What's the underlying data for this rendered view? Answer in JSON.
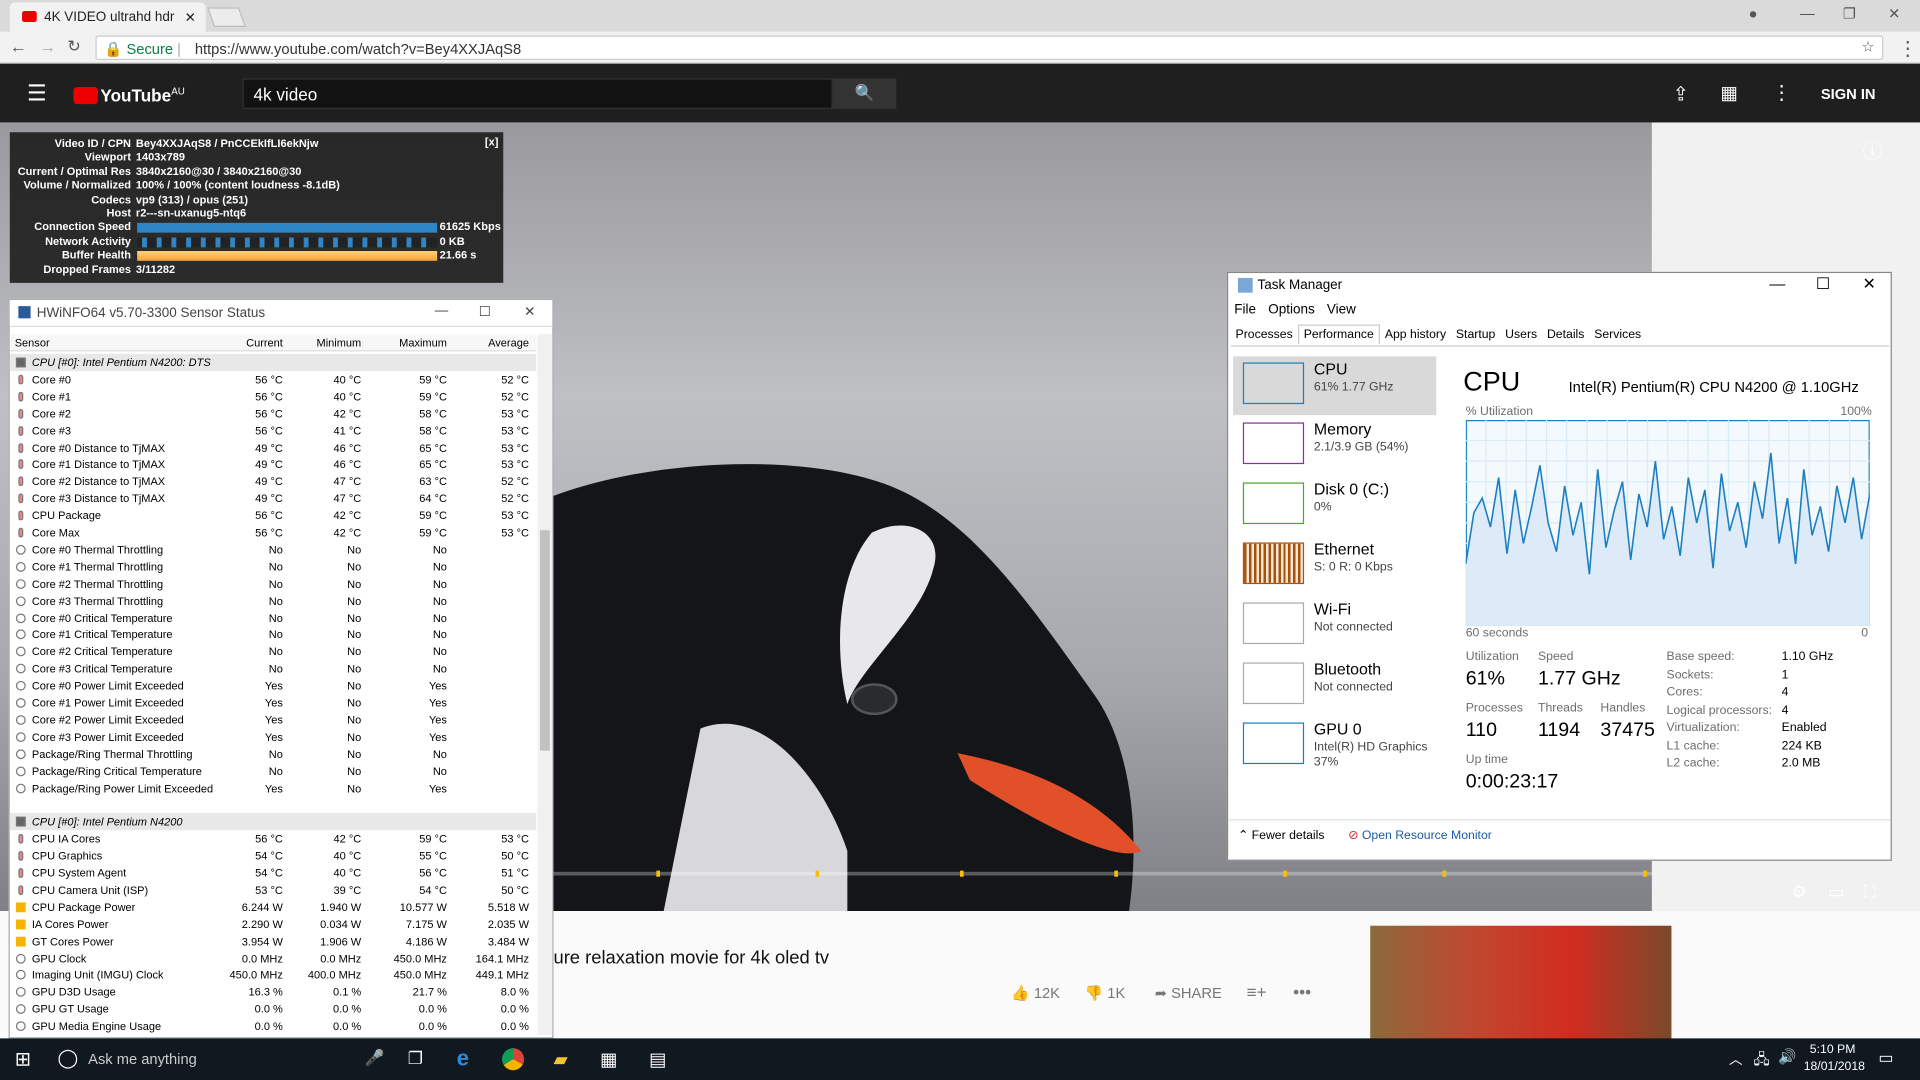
{
  "browser": {
    "tab_title": "4K VIDEO ultrahd hdr",
    "secure": "Secure",
    "url": "https://www.youtube.com/watch?v=Bey4XXJAqS8"
  },
  "youtube": {
    "logo": "YouTube",
    "region": "AU",
    "search_value": "4k video",
    "signin": "SIGN IN",
    "video_title": "ure relaxation movie for 4k oled tv",
    "likes": "12K",
    "dislikes": "1K",
    "share": "SHARE"
  },
  "stats": [
    {
      "label": "Video ID / CPN",
      "value": "Bey4XXJAqS8 / PnCCEkIfLI6ekNjw"
    },
    {
      "label": "Viewport",
      "value": "1403x789"
    },
    {
      "label": "Current / Optimal Res",
      "value": "3840x2160@30 / 3840x2160@30"
    },
    {
      "label": "Volume / Normalized",
      "value": "100% / 100% (content loudness -8.1dB)"
    },
    {
      "label": "Codecs",
      "value": "vp9 (313) / opus (251)"
    },
    {
      "label": "Host",
      "value": "r2---sn-uxanug5-ntq6"
    },
    {
      "label": "Connection Speed",
      "value": "61625 Kbps"
    },
    {
      "label": "Network Activity",
      "value": "0 KB"
    },
    {
      "label": "Buffer Health",
      "value": "21.66 s"
    },
    {
      "label": "Dropped Frames",
      "value": "3/11282"
    }
  ],
  "hwinfo": {
    "title": "HWiNFO64 v5.70-3300 Sensor Status",
    "columns": [
      "Sensor",
      "Current",
      "Minimum",
      "Maximum",
      "Average"
    ],
    "rows": [
      [
        "CPU [#0]: Intel Pentium N4200: DTS",
        "",
        "",
        "",
        ""
      ],
      [
        "Core #0",
        "56 °C",
        "40 °C",
        "59 °C",
        "52 °C"
      ],
      [
        "Core #1",
        "56 °C",
        "40 °C",
        "59 °C",
        "52 °C"
      ],
      [
        "Core #2",
        "56 °C",
        "42 °C",
        "58 °C",
        "53 °C"
      ],
      [
        "Core #3",
        "56 °C",
        "41 °C",
        "58 °C",
        "53 °C"
      ],
      [
        "Core #0 Distance to TjMAX",
        "49 °C",
        "46 °C",
        "65 °C",
        "53 °C"
      ],
      [
        "Core #1 Distance to TjMAX",
        "49 °C",
        "46 °C",
        "65 °C",
        "53 °C"
      ],
      [
        "Core #2 Distance to TjMAX",
        "49 °C",
        "47 °C",
        "63 °C",
        "52 °C"
      ],
      [
        "Core #3 Distance to TjMAX",
        "49 °C",
        "47 °C",
        "64 °C",
        "52 °C"
      ],
      [
        "CPU Package",
        "56 °C",
        "42 °C",
        "59 °C",
        "53 °C"
      ],
      [
        "Core Max",
        "56 °C",
        "42 °C",
        "59 °C",
        "53 °C"
      ],
      [
        "Core #0 Thermal Throttling",
        "No",
        "No",
        "No",
        ""
      ],
      [
        "Core #1 Thermal Throttling",
        "No",
        "No",
        "No",
        ""
      ],
      [
        "Core #2 Thermal Throttling",
        "No",
        "No",
        "No",
        ""
      ],
      [
        "Core #3 Thermal Throttling",
        "No",
        "No",
        "No",
        ""
      ],
      [
        "Core #0 Critical Temperature",
        "No",
        "No",
        "No",
        ""
      ],
      [
        "Core #1 Critical Temperature",
        "No",
        "No",
        "No",
        ""
      ],
      [
        "Core #2 Critical Temperature",
        "No",
        "No",
        "No",
        ""
      ],
      [
        "Core #3 Critical Temperature",
        "No",
        "No",
        "No",
        ""
      ],
      [
        "Core #0 Power Limit Exceeded",
        "Yes",
        "No",
        "Yes",
        ""
      ],
      [
        "Core #1 Power Limit Exceeded",
        "Yes",
        "No",
        "Yes",
        ""
      ],
      [
        "Core #2 Power Limit Exceeded",
        "Yes",
        "No",
        "Yes",
        ""
      ],
      [
        "Core #3 Power Limit Exceeded",
        "Yes",
        "No",
        "Yes",
        ""
      ],
      [
        "Package/Ring Thermal Throttling",
        "No",
        "No",
        "No",
        ""
      ],
      [
        "Package/Ring Critical Temperature",
        "No",
        "No",
        "No",
        ""
      ],
      [
        "Package/Ring Power Limit Exceeded",
        "Yes",
        "No",
        "Yes",
        ""
      ],
      [
        "",
        "",
        "",
        "",
        ""
      ],
      [
        "CPU [#0]: Intel Pentium N4200",
        "",
        "",
        "",
        ""
      ],
      [
        "CPU IA Cores",
        "56 °C",
        "42 °C",
        "59 °C",
        "53 °C"
      ],
      [
        "CPU Graphics",
        "54 °C",
        "40 °C",
        "55 °C",
        "50 °C"
      ],
      [
        "CPU System Agent",
        "54 °C",
        "40 °C",
        "56 °C",
        "51 °C"
      ],
      [
        "CPU Camera Unit (ISP)",
        "53 °C",
        "39 °C",
        "54 °C",
        "50 °C"
      ],
      [
        "CPU Package Power",
        "6.244 W",
        "1.940 W",
        "10.577 W",
        "5.518 W"
      ],
      [
        "IA Cores Power",
        "2.290 W",
        "0.034 W",
        "7.175 W",
        "2.035 W"
      ],
      [
        "GT Cores Power",
        "3.954 W",
        "1.906 W",
        "4.186 W",
        "3.484 W"
      ],
      [
        "GPU Clock",
        "0.0 MHz",
        "0.0 MHz",
        "450.0 MHz",
        "164.1 MHz"
      ],
      [
        "Imaging Unit (IMGU) Clock",
        "450.0 MHz",
        "400.0 MHz",
        "450.0 MHz",
        "449.1 MHz"
      ],
      [
        "GPU D3D Usage",
        "16.3 %",
        "0.1 %",
        "21.7 %",
        "8.0 %"
      ],
      [
        "GPU GT Usage",
        "0.0 %",
        "0.0 %",
        "0.0 %",
        "0.0 %"
      ],
      [
        "GPU Media Engine Usage",
        "0.0 %",
        "0.0 %",
        "0.0 %",
        "0.0 %"
      ]
    ]
  },
  "taskmgr": {
    "title": "Task Manager",
    "menu": [
      "File",
      "Options",
      "View"
    ],
    "tabs": [
      "Processes",
      "Performance",
      "App history",
      "Startup",
      "Users",
      "Details",
      "Services"
    ],
    "side": [
      {
        "name": "CPU",
        "sub": "61%  1.77 GHz",
        "color": "#1c7fc1"
      },
      {
        "name": "Memory",
        "sub": "2.1/3.9 GB (54%)",
        "color": "#8b2f9d"
      },
      {
        "name": "Disk 0 (C:)",
        "sub": "0%",
        "color": "#4ca730"
      },
      {
        "name": "Ethernet",
        "sub": "S: 0  R: 0 Kbps",
        "color": "#a7520b"
      },
      {
        "name": "Wi-Fi",
        "sub": "Not connected",
        "color": "#aaaaaa"
      },
      {
        "name": "Bluetooth",
        "sub": "Not connected",
        "color": "#aaaaaa"
      },
      {
        "name": "GPU 0",
        "sub": "Intel(R) HD Graphics",
        "sub2": "37%",
        "color": "#1c7fc1"
      }
    ],
    "cpu_title": "CPU",
    "cpu_model": "Intel(R) Pentium(R) CPU N4200 @ 1.10GHz",
    "util_label": "% Utilization",
    "util_max": "100%",
    "time_label": "60 seconds",
    "time_min": "0",
    "graph": [
      30,
      55,
      62,
      48,
      72,
      35,
      66,
      40,
      58,
      78,
      50,
      36,
      68,
      44,
      60,
      25,
      76,
      38,
      56,
      70,
      32,
      64,
      48,
      80,
      42,
      58,
      34,
      72,
      50,
      66,
      28,
      74,
      46,
      60,
      38,
      70,
      52,
      84,
      40,
      62,
      30,
      76,
      44,
      58,
      36,
      68,
      50,
      72,
      42,
      64
    ],
    "stats": {
      "utilization_label": "Utilization",
      "utilization": "61%",
      "speed_label": "Speed",
      "speed": "1.77 GHz",
      "processes_label": "Processes",
      "processes": "110",
      "threads_label": "Threads",
      "threads": "1194",
      "handles_label": "Handles",
      "handles": "37475",
      "uptime_label": "Up time",
      "uptime": "0:00:23:17"
    },
    "info": [
      [
        "Base speed:",
        "1.10 GHz"
      ],
      [
        "Sockets:",
        "1"
      ],
      [
        "Cores:",
        "4"
      ],
      [
        "Logical processors:",
        "4"
      ],
      [
        "Virtualization:",
        "Enabled"
      ],
      [
        "L1 cache:",
        "224 KB"
      ],
      [
        "L2 cache:",
        "2.0 MB"
      ]
    ],
    "fewer": "Fewer details",
    "resmon": "Open Resource Monitor"
  },
  "taskbar": {
    "search": "Ask me anything",
    "time": "5:10 PM",
    "date": "18/01/2018"
  }
}
